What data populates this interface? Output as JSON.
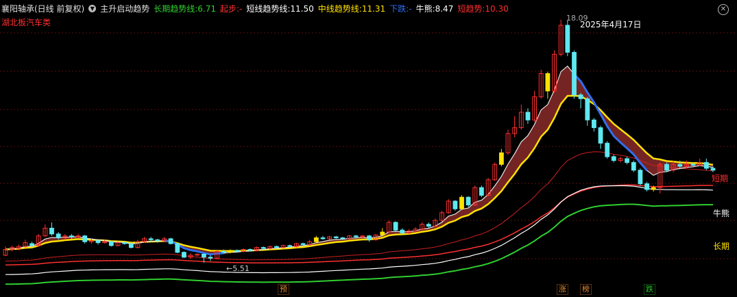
{
  "header": {
    "stock": "襄阳轴承(日线 前复权)",
    "indicator_icon": "circle-chevron-icon",
    "indicator": "主升启动趋势",
    "long_label": "长期趋势线:",
    "long_value": "6.71",
    "start_label": "起步:",
    "start_value": "-",
    "short_label": "短线趋势线:",
    "short_value": "11.50",
    "mid_label": "中线趋势线:",
    "mid_value": "11.31",
    "down_label": "下跌:",
    "down_value": "-",
    "bear_label": "牛熊:",
    "bear_value": "8.47",
    "shortrend_label": "短趋势:",
    "shortrend_value": "10.30"
  },
  "sector": "湖北板汽车类",
  "annotations": {
    "peak_date": "2025年4月17日",
    "peak_value": "18.09",
    "low_value": "5.51",
    "low_arrow": "←"
  },
  "right_labels": {
    "short": "短期",
    "bear": "牛熊",
    "long": "长期"
  },
  "signals": [
    {
      "label": "预",
      "color": "#e08a2e"
    },
    {
      "label": "涨",
      "color": "#e08a2e"
    },
    {
      "label": "榜",
      "color": "#e08a2e"
    },
    {
      "label": "跌",
      "color": "#26c426"
    }
  ],
  "colors": {
    "up": "#ff3030",
    "down": "#5ee8f0",
    "yellow": "#ffe100",
    "long": "#30d030",
    "mid": "#ffffff",
    "short": "#ff3030",
    "band": "#b03030",
    "bluetrend": "#2f6ff0"
  },
  "chart_data": {
    "type": "candlestick",
    "ylim": [
      4.8,
      18.4
    ],
    "candles": [
      [
        5.9,
        6.2,
        6.35,
        5.85
      ],
      [
        6.2,
        6.3,
        6.4,
        6.1
      ],
      [
        6.25,
        6.35,
        6.45,
        6.15
      ],
      [
        6.35,
        6.55,
        6.7,
        6.3
      ],
      [
        6.5,
        6.4,
        6.6,
        6.3
      ],
      [
        6.4,
        6.9,
        7.0,
        6.35
      ],
      [
        6.9,
        7.3,
        7.5,
        6.85
      ],
      [
        7.3,
        7.0,
        7.6,
        6.9
      ],
      [
        7.0,
        6.8,
        7.1,
        6.7
      ],
      [
        6.8,
        6.9,
        7.0,
        6.7
      ],
      [
        6.9,
        6.85,
        7.0,
        6.75
      ],
      [
        6.85,
        6.9,
        7.0,
        6.8
      ],
      [
        6.9,
        6.6,
        6.95,
        6.5
      ],
      [
        6.6,
        6.65,
        6.75,
        6.5
      ],
      [
        6.65,
        6.55,
        6.7,
        6.45
      ],
      [
        6.55,
        6.6,
        6.7,
        6.5
      ],
      [
        6.6,
        6.4,
        6.65,
        6.35
      ],
      [
        6.4,
        6.55,
        6.6,
        6.35
      ],
      [
        6.55,
        6.5,
        6.6,
        6.45
      ],
      [
        6.5,
        6.3,
        6.55,
        6.25
      ],
      [
        6.3,
        6.6,
        6.7,
        6.25
      ],
      [
        6.6,
        6.75,
        6.85,
        6.55
      ],
      [
        6.75,
        6.7,
        6.85,
        6.6
      ],
      [
        6.7,
        6.65,
        6.75,
        6.55
      ],
      [
        6.65,
        6.75,
        6.85,
        6.6
      ],
      [
        6.75,
        6.5,
        6.8,
        6.45
      ],
      [
        6.5,
        6.05,
        6.55,
        6.0
      ],
      [
        6.05,
        5.8,
        6.1,
        5.75
      ],
      [
        5.8,
        5.9,
        6.0,
        5.7
      ],
      [
        5.9,
        5.95,
        6.0,
        5.85
      ],
      [
        5.95,
        5.8,
        6.0,
        5.51
      ],
      [
        5.8,
        5.75,
        5.9,
        5.6
      ],
      [
        5.75,
        6.1,
        6.15,
        5.7
      ],
      [
        6.1,
        6.05,
        6.2,
        6.0
      ],
      [
        6.05,
        6.15,
        6.2,
        6.0
      ],
      [
        6.15,
        6.1,
        6.2,
        6.05
      ],
      [
        6.1,
        6.2,
        6.25,
        6.05
      ],
      [
        6.2,
        6.15,
        6.25,
        6.1
      ],
      [
        6.15,
        6.3,
        6.35,
        6.1
      ],
      [
        6.3,
        6.25,
        6.35,
        6.2
      ],
      [
        6.25,
        6.35,
        6.4,
        6.2
      ],
      [
        6.35,
        6.3,
        6.4,
        6.25
      ],
      [
        6.3,
        6.4,
        6.45,
        6.25
      ],
      [
        6.4,
        6.35,
        6.45,
        6.3
      ],
      [
        6.35,
        6.5,
        6.55,
        6.3
      ],
      [
        6.5,
        6.45,
        6.55,
        6.4
      ],
      [
        6.45,
        6.6,
        6.7,
        6.4
      ],
      [
        6.6,
        6.8,
        6.9,
        6.55
      ],
      [
        6.8,
        6.75,
        6.9,
        6.7
      ],
      [
        6.75,
        6.85,
        6.9,
        6.7
      ],
      [
        6.85,
        6.8,
        6.9,
        6.75
      ],
      [
        6.8,
        6.75,
        6.85,
        6.7
      ],
      [
        6.75,
        6.9,
        6.95,
        6.7
      ],
      [
        6.9,
        6.85,
        6.95,
        6.8
      ],
      [
        6.85,
        6.9,
        6.95,
        6.8
      ],
      [
        6.9,
        6.7,
        6.95,
        6.6
      ],
      [
        6.7,
        6.95,
        7.0,
        6.65
      ],
      [
        6.95,
        7.1,
        7.3,
        6.9
      ],
      [
        7.1,
        7.6,
        7.7,
        7.05
      ],
      [
        7.6,
        7.2,
        7.65,
        7.1
      ],
      [
        7.2,
        7.05,
        7.3,
        7.0
      ],
      [
        7.05,
        7.15,
        7.25,
        7.0
      ],
      [
        7.15,
        7.25,
        7.35,
        7.1
      ],
      [
        7.25,
        7.5,
        7.6,
        7.2
      ],
      [
        7.5,
        7.4,
        7.6,
        7.3
      ],
      [
        7.4,
        7.7,
        7.8,
        7.35
      ],
      [
        7.7,
        8.1,
        8.2,
        7.65
      ],
      [
        8.1,
        8.7,
        8.8,
        8.05
      ],
      [
        8.7,
        8.3,
        8.75,
        8.2
      ],
      [
        8.3,
        8.9,
        9.0,
        8.25
      ],
      [
        8.9,
        8.5,
        8.95,
        8.4
      ],
      [
        8.5,
        9.4,
        9.5,
        8.45
      ],
      [
        9.4,
        9.0,
        9.5,
        8.9
      ],
      [
        9.0,
        9.8,
        9.9,
        8.95
      ],
      [
        9.8,
        10.6,
        10.7,
        9.75
      ],
      [
        10.6,
        11.2,
        11.4,
        10.5
      ],
      [
        11.2,
        12.2,
        12.4,
        11.1
      ],
      [
        12.2,
        12.5,
        13.1,
        12.0
      ],
      [
        12.5,
        13.3,
        13.7,
        12.4
      ],
      [
        13.3,
        12.9,
        13.5,
        12.7
      ],
      [
        12.9,
        14.1,
        14.4,
        12.8
      ],
      [
        14.1,
        15.3,
        15.5,
        14.0
      ],
      [
        15.3,
        14.4,
        15.4,
        14.0
      ],
      [
        14.4,
        16.3,
        16.5,
        14.3
      ],
      [
        16.3,
        17.8,
        18.09,
        16.2
      ],
      [
        17.8,
        16.4,
        18.09,
        16.2
      ],
      [
        16.4,
        14.2,
        16.5,
        14.0
      ],
      [
        14.2,
        14.0,
        14.3,
        13.5
      ],
      [
        14.0,
        12.9,
        14.1,
        12.6
      ],
      [
        12.9,
        12.5,
        13.0,
        12.3
      ],
      [
        12.5,
        11.7,
        12.6,
        11.4
      ],
      [
        11.7,
        11.0,
        11.8,
        10.9
      ],
      [
        11.0,
        10.8,
        11.1,
        10.7
      ],
      [
        10.8,
        10.9,
        11.0,
        10.7
      ],
      [
        10.9,
        10.7,
        11.0,
        10.6
      ],
      [
        10.7,
        10.3,
        10.8,
        10.2
      ],
      [
        10.3,
        9.6,
        10.4,
        9.5
      ],
      [
        9.6,
        9.3,
        9.7,
        9.2
      ],
      [
        9.3,
        9.4,
        9.5,
        9.2
      ],
      [
        9.4,
        10.6,
        10.7,
        9.1
      ],
      [
        10.6,
        10.3,
        10.7,
        10.2
      ],
      [
        10.3,
        10.6,
        10.8,
        10.2
      ],
      [
        10.6,
        10.5,
        10.8,
        10.4
      ],
      [
        10.5,
        10.6,
        10.8,
        10.4
      ],
      [
        10.6,
        10.55,
        10.7,
        10.5
      ],
      [
        10.55,
        10.7,
        10.9,
        10.5
      ],
      [
        10.7,
        10.4,
        10.9,
        10.3
      ],
      [
        10.4,
        10.3,
        10.5,
        10.2
      ]
    ]
  }
}
